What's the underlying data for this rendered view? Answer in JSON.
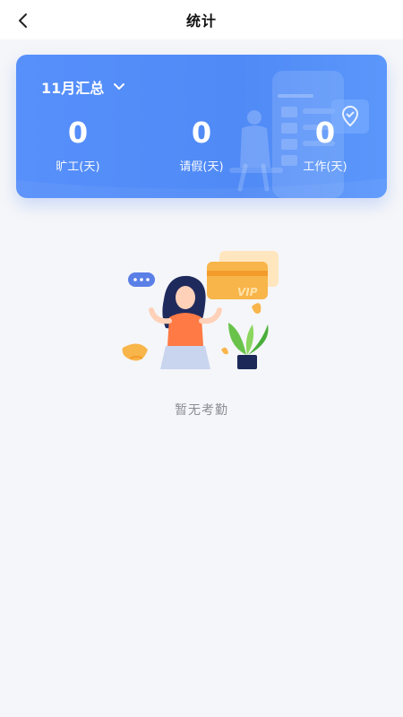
{
  "header": {
    "title": "统计",
    "back_icon": "chevron-left-icon"
  },
  "summary": {
    "month_label": "11月汇总",
    "dropdown_icon": "chevron-down-icon",
    "stats": [
      {
        "value": "0",
        "label": "旷工(天)"
      },
      {
        "value": "0",
        "label": "请假(天)"
      },
      {
        "value": "0",
        "label": "工作(天)"
      }
    ],
    "accent": "#5790fb"
  },
  "empty_state": {
    "text": "暂无考勤",
    "illustration": "woman-shrugging-illustration",
    "badge_text": "VIP"
  }
}
